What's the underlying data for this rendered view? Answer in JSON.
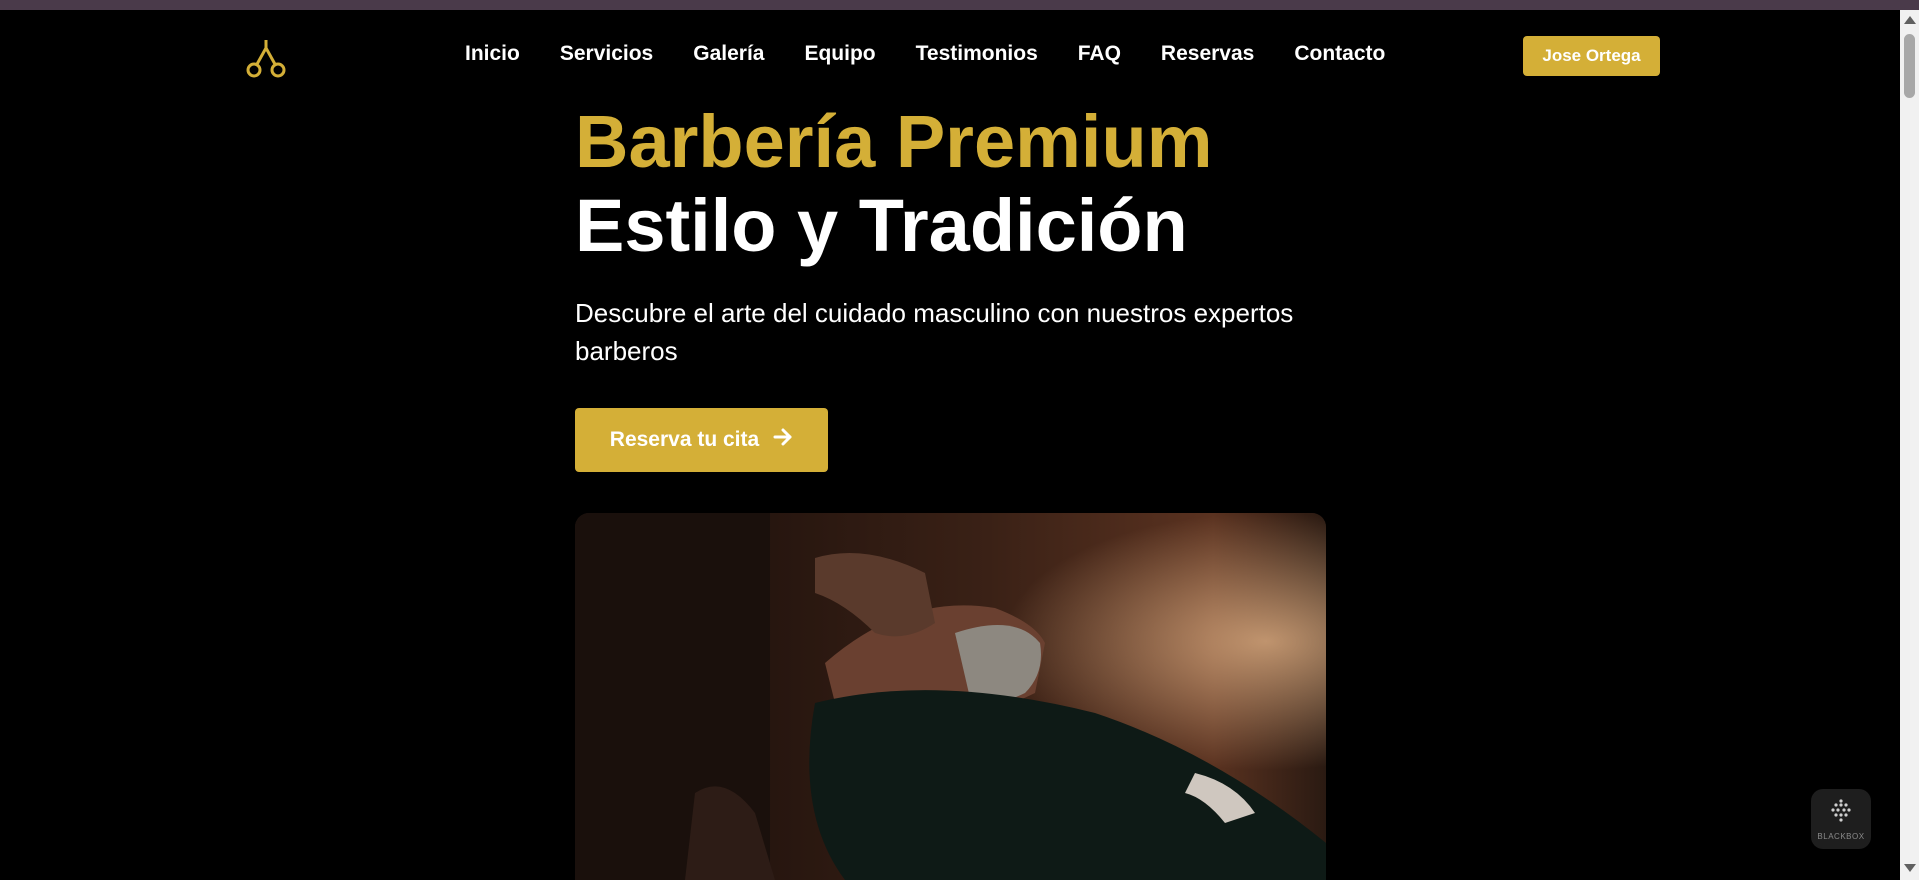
{
  "nav": {
    "links": [
      "Inicio",
      "Servicios",
      "Galería",
      "Equipo",
      "Testimonios",
      "FAQ",
      "Reservas",
      "Contacto"
    ],
    "user_label": "Jose Ortega"
  },
  "hero": {
    "title_accent": "Barbería Premium",
    "title_main": "Estilo y Tradición",
    "subtitle": "Descubre el arte del cuidado masculino con nuestros expertos barberos",
    "cta_label": "Reserva tu cita"
  },
  "widget": {
    "label": "BLACKBOX"
  },
  "icons": {
    "logo": "scissors-icon",
    "cta": "arrow-right-icon",
    "widget": "blackbox-icon"
  },
  "colors": {
    "accent": "#d4af37",
    "background": "#000000",
    "text": "#ffffff"
  }
}
